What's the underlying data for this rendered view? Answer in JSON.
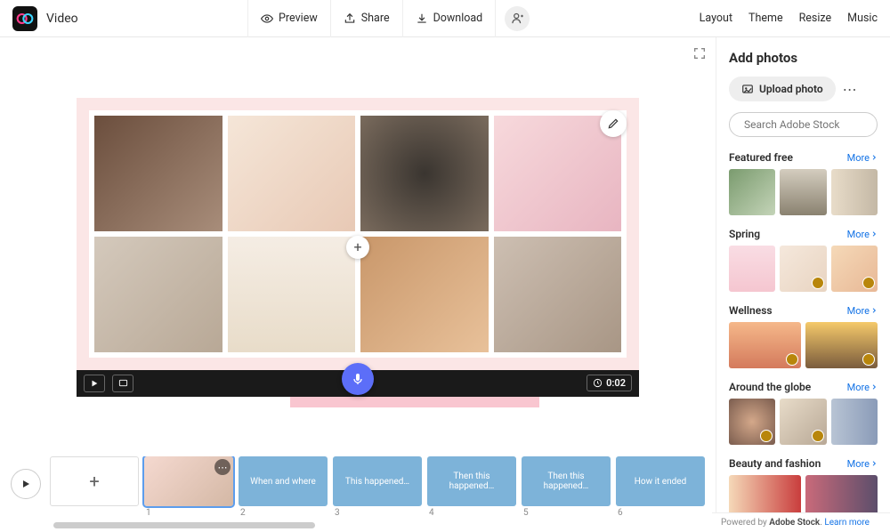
{
  "header": {
    "title": "Video",
    "preview": "Preview",
    "share": "Share",
    "download": "Download",
    "right": [
      "Layout",
      "Theme",
      "Resize",
      "Music"
    ]
  },
  "canvas": {
    "duration": "0:02"
  },
  "timeline": {
    "items": [
      {
        "num": "",
        "type": "add"
      },
      {
        "num": "1",
        "type": "thumb"
      },
      {
        "num": "2",
        "type": "txt",
        "label": "When and where"
      },
      {
        "num": "3",
        "type": "txt",
        "label": "This happened…"
      },
      {
        "num": "4",
        "type": "txt",
        "label": "Then this happened…"
      },
      {
        "num": "5",
        "type": "txt",
        "label": "Then this happened…"
      },
      {
        "num": "6",
        "type": "txt",
        "label": "How it ended"
      }
    ]
  },
  "sidebar": {
    "title": "Add photos",
    "upload": "Upload photo",
    "searchPlaceholder": "Search Adobe Stock",
    "more": "More",
    "categories": [
      {
        "title": "Featured free",
        "thumbs": [
          "t1",
          "t2",
          "t3"
        ],
        "premium": [
          false,
          false,
          false
        ]
      },
      {
        "title": "Spring",
        "thumbs": [
          "t4",
          "t5",
          "t6"
        ],
        "premium": [
          false,
          true,
          true
        ]
      },
      {
        "title": "Wellness",
        "thumbs": [
          "t7",
          "t8"
        ],
        "premium": [
          true,
          true
        ]
      },
      {
        "title": "Around the globe",
        "thumbs": [
          "t9",
          "t10",
          "t11"
        ],
        "premium": [
          true,
          true,
          false
        ]
      },
      {
        "title": "Beauty and fashion",
        "thumbs": [
          "t12",
          "t13"
        ],
        "premium": [
          false,
          false
        ]
      }
    ]
  },
  "footer": {
    "prefix": "Powered by ",
    "brand": "Adobe Stock",
    "learn": "Learn more"
  }
}
